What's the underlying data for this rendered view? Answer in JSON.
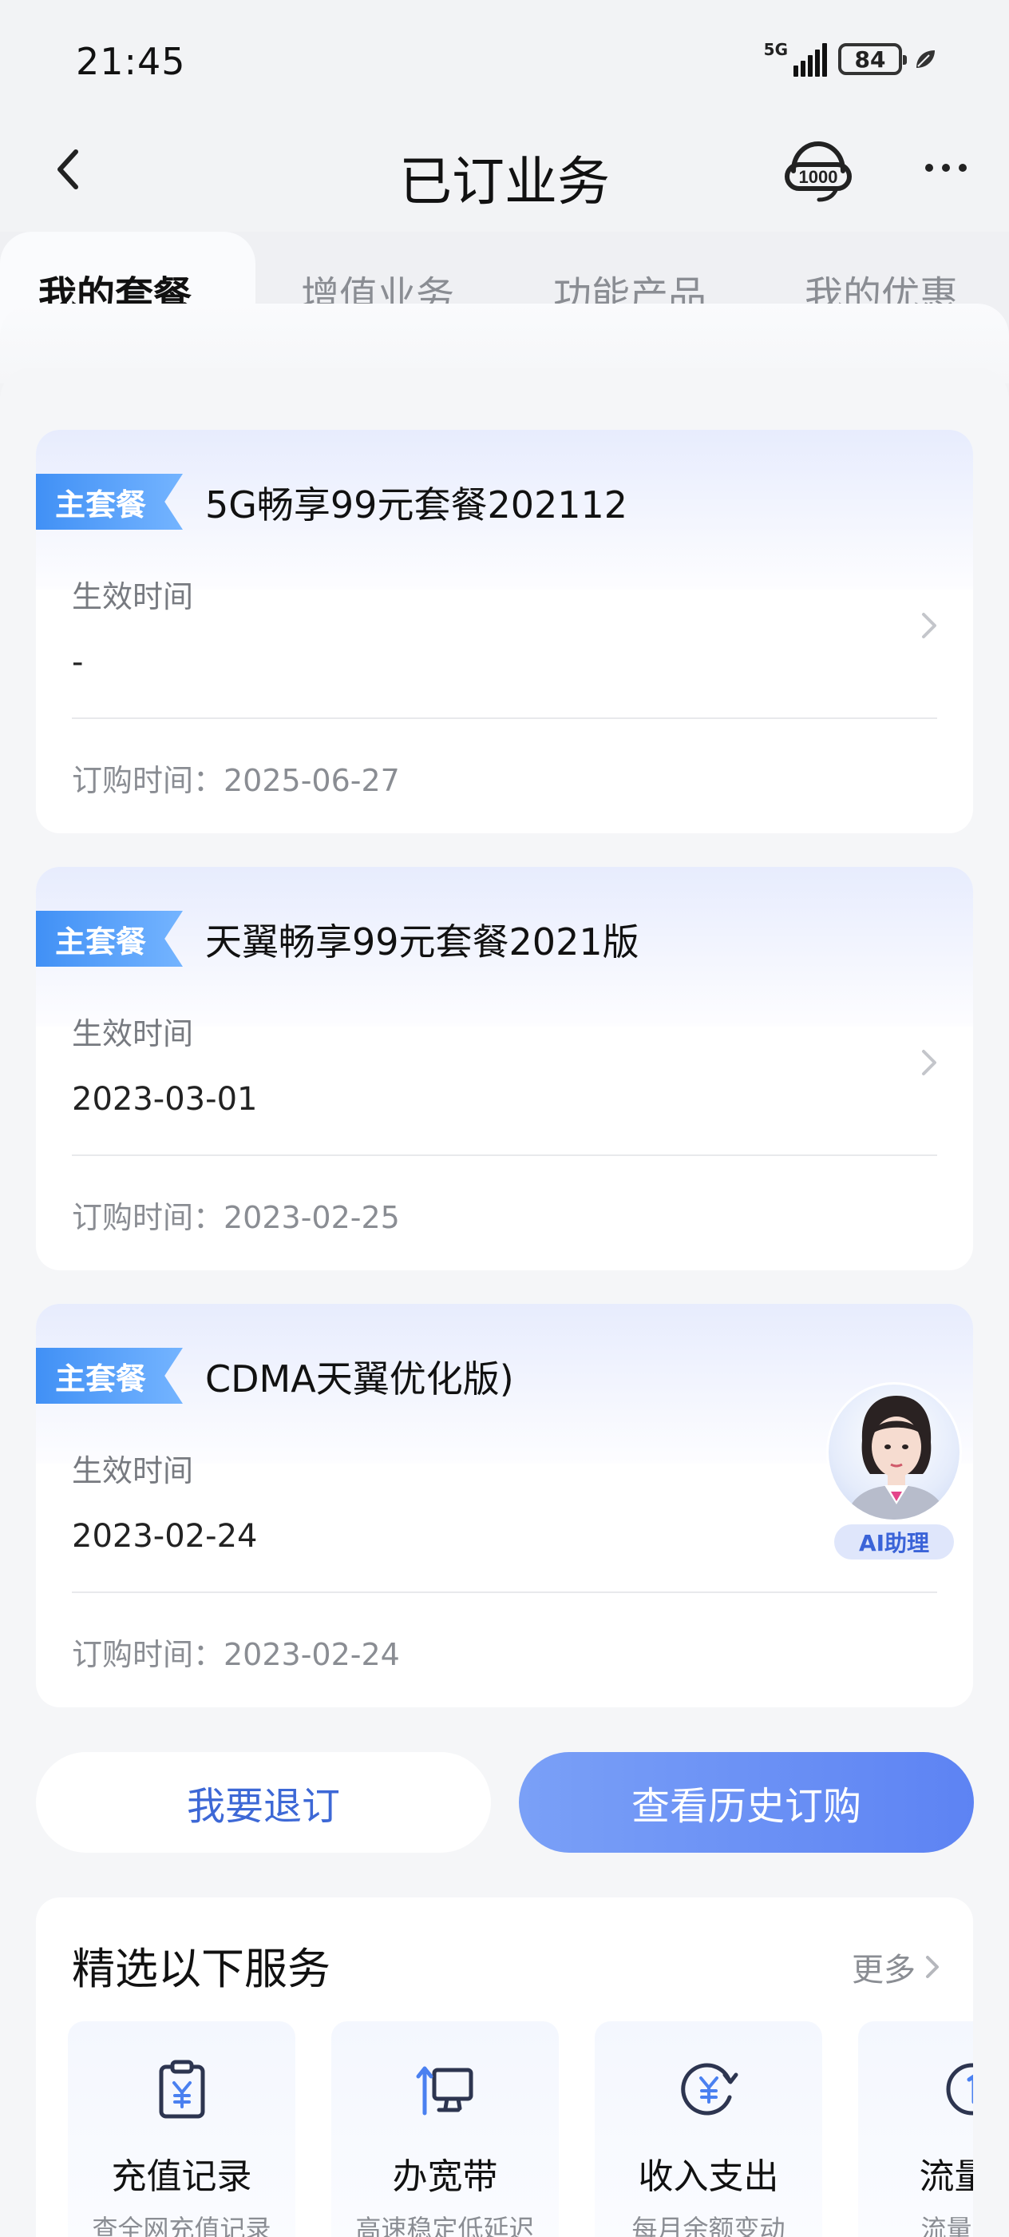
{
  "status": {
    "time": "21:45",
    "network": "5G",
    "battery": "84"
  },
  "header": {
    "title": "已订业务"
  },
  "tabs": [
    {
      "label": "我的套餐",
      "active": true
    },
    {
      "label": "增值业务",
      "active": false
    },
    {
      "label": "功能产品",
      "active": false
    },
    {
      "label": "我的优惠",
      "active": false
    }
  ],
  "packages": [
    {
      "tag": "主套餐",
      "name": "5G畅享99元套餐202112",
      "effective_label": "生效时间",
      "effective_value": "-",
      "order_time": "订购时间：2025-06-27"
    },
    {
      "tag": "主套餐",
      "name": "天翼畅享99元套餐2021版",
      "effective_label": "生效时间",
      "effective_value": "2023-03-01",
      "order_time": "订购时间：2023-02-25"
    },
    {
      "tag": "主套餐",
      "name": "CDMA天翼优化版)",
      "effective_label": "生效时间",
      "effective_value": "2023-02-24",
      "order_time": "订购时间：2023-02-24"
    }
  ],
  "ai_assistant": {
    "label": "AI助理"
  },
  "actions": {
    "unsubscribe": "我要退订",
    "history": "查看历史订购"
  },
  "services": {
    "title": "精选以下服务",
    "more": "更多",
    "items": [
      {
        "label": "充值记录",
        "sub": "查全网充值记录",
        "icon": "recharge-record-icon"
      },
      {
        "label": "办宽带",
        "sub": "高速稳定低延迟",
        "icon": "broadband-icon"
      },
      {
        "label": "收入支出",
        "sub": "每月余额变动",
        "icon": "income-expense-icon"
      },
      {
        "label": "流量加",
        "sub": "流量告急",
        "icon": "data-addon-icon"
      }
    ]
  },
  "colors": {
    "accent": "#5d83f3",
    "tag": "#3f8ff5",
    "text_secondary": "#8a8d93"
  }
}
